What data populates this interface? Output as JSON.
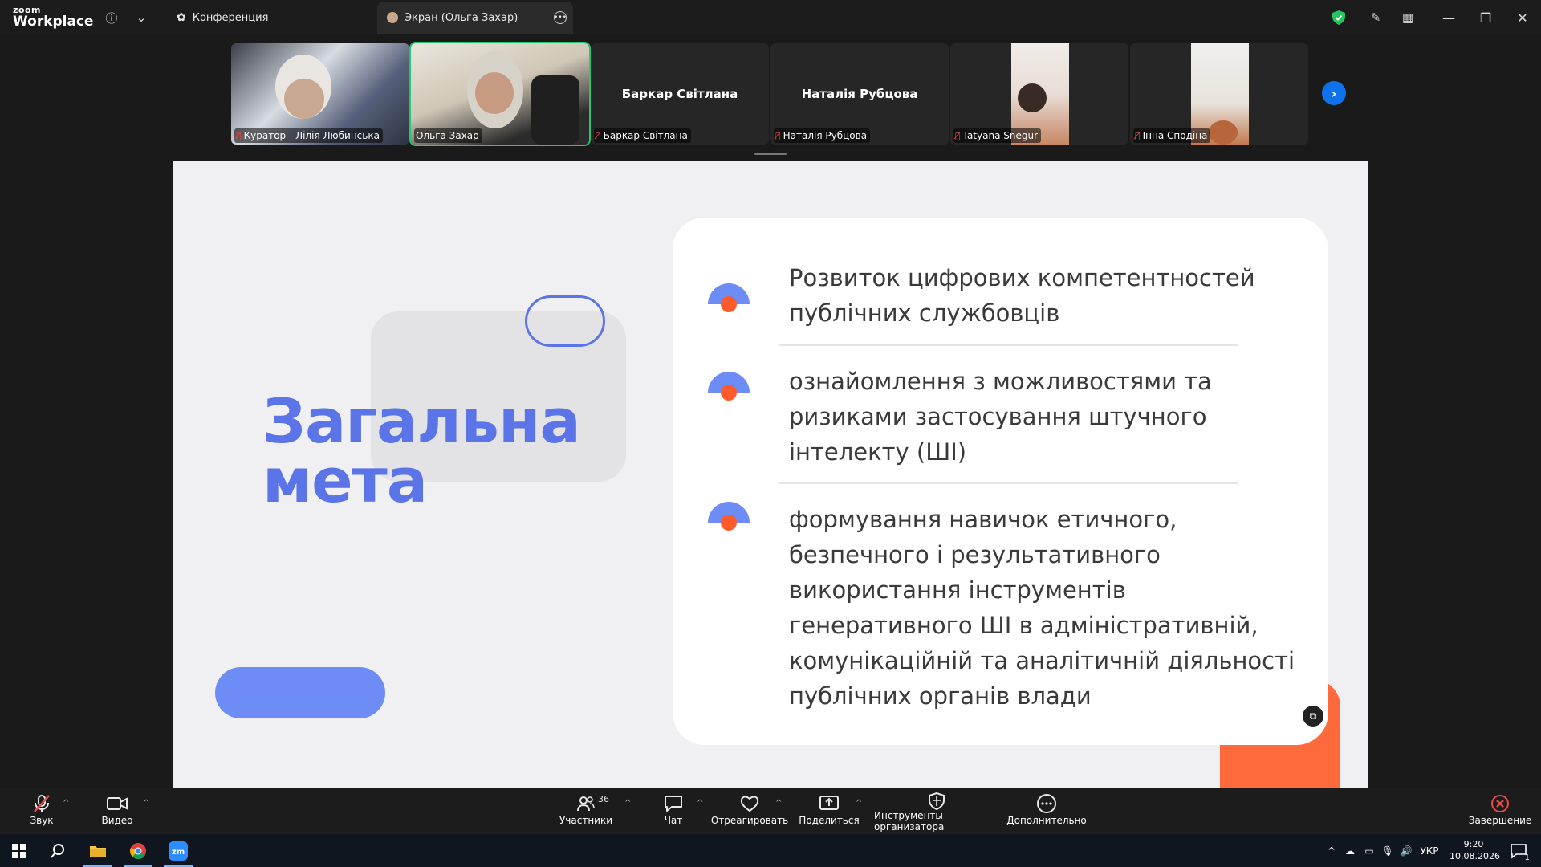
{
  "titlebar": {
    "logo_small": "zoom",
    "logo_big": "Workplace",
    "tabs": [
      {
        "label": "Конференция"
      },
      {
        "label": "Экран (Ольга Захар)"
      }
    ]
  },
  "gallery": {
    "participants": [
      {
        "label": "Куратор - Лілія Любинська"
      },
      {
        "label": "Ольга Захар"
      },
      {
        "label": "Баркар Світлана",
        "center_name": "Баркар Світлана"
      },
      {
        "label": "Наталія Рубцова",
        "center_name": "Наталія Рубцова"
      },
      {
        "label": "Tatyana Snegur"
      },
      {
        "label": "Інна Сподіна"
      }
    ]
  },
  "slide": {
    "title_line1": "Загальна",
    "title_line2": "мета",
    "items": [
      {
        "text": "Розвиток цифрових компетентностей публічних службовців"
      },
      {
        "text": "ознайомлення з можливостями та ризиками застосування штучного інтелекту (ШІ)"
      },
      {
        "text": "формування навичок етичного, безпечного і результативного використання інструментів генеративного ШІ в адміністративній, комунікаційній та аналітичній діяльності публічних органів влади"
      }
    ],
    "colors": {
      "accent_blue": "#5b74e8",
      "accent_orange": "#ff6a3d"
    }
  },
  "toolbar": {
    "audio": "Звук",
    "video": "Видео",
    "participants": "Участники",
    "participants_count": "36",
    "chat": "Чат",
    "react": "Отреагировать",
    "share": "Поделиться",
    "host_tools": "Инструменты организатора",
    "more": "Дополнительно",
    "end": "Завершение"
  },
  "taskbar": {
    "language": "УКР",
    "time": "9:20",
    "date": "10.08.2026",
    "notifications": "1"
  }
}
